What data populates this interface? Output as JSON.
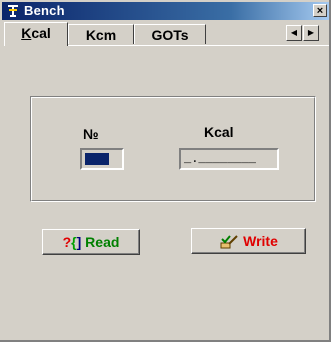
{
  "window": {
    "title": "Bench",
    "close_label": "×"
  },
  "tabs": [
    {
      "label_first": "K",
      "label_rest": "cal",
      "active": true
    },
    {
      "label": "Kcm"
    },
    {
      "label": "GOTs"
    }
  ],
  "tab_scroll": {
    "left": "◀",
    "right": "▶"
  },
  "group": {
    "number_label": "№",
    "kcal_label": "Kcal",
    "kcal_value": "_.________"
  },
  "buttons": {
    "read_icon_a": "?",
    "read_icon_b": "{",
    "read_icon_c": "]",
    "read_label": "Read",
    "write_label": "Write",
    "write_icon": "brush-icon"
  },
  "colors": {
    "title_bar": "#0a246a",
    "face": "#d4d0c8",
    "read_text": "#008000",
    "write_text": "#e00000"
  }
}
